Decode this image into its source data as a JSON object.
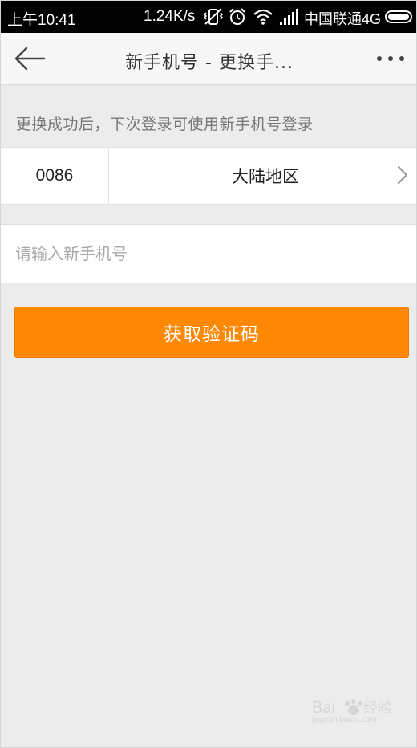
{
  "status_bar": {
    "time": "上午10:41",
    "network_speed": "1.24K/s",
    "carrier": "中国联通4G",
    "icons": [
      "vibrate-off-icon",
      "alarm-icon",
      "wifi-icon",
      "signal-icon",
      "battery-icon"
    ]
  },
  "nav": {
    "title": "新手机号 - 更换手...",
    "back_icon": "back-arrow-icon",
    "more_icon": "more-dots-icon"
  },
  "hint": "更换成功后，下次登录可使用新手机号登录",
  "region": {
    "code": "0086",
    "name": "大陆地区"
  },
  "phone_input": {
    "value": "",
    "placeholder": "请输入新手机号"
  },
  "submit_button": {
    "label": "获取验证码"
  },
  "watermark": {
    "text": "jingyan.baidu.com"
  },
  "colors": {
    "accent": "#ff8805",
    "background": "#ececec",
    "status_bar": "#000000"
  }
}
